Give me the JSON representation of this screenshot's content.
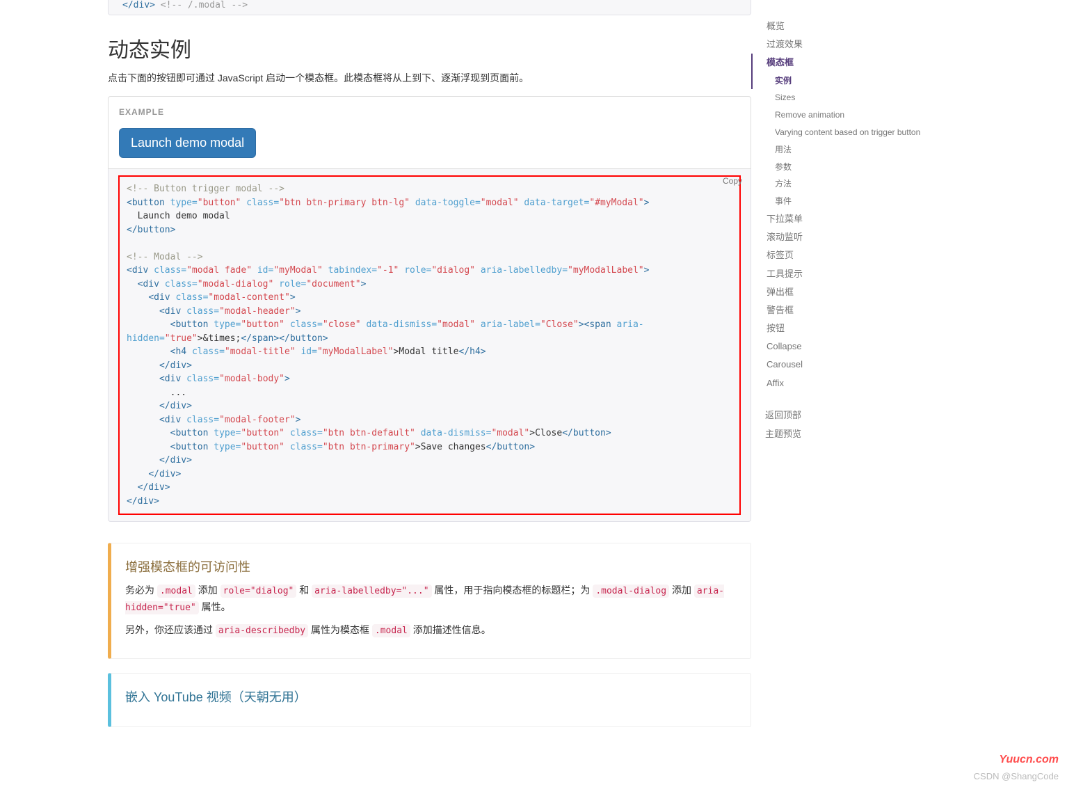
{
  "truncated_top": {
    "tag_close": "</div>",
    "comment": "<!-- /.modal -->"
  },
  "section": {
    "title": "动态实例",
    "lead": "点击下面的按钮即可通过 JavaScript 启动一个模态框。此模态框将从上到下、逐渐浮现到页面前。"
  },
  "example": {
    "label": "EXAMPLE",
    "button_label": "Launch demo modal"
  },
  "copy_label": "Copy",
  "code": {
    "c1": "<!-- Button trigger modal -->",
    "btn_open": "<button",
    "a_type": "type=",
    "v_button": "\"button\"",
    "a_class": "class=",
    "v_btn_primary": "\"btn btn-primary btn-lg\"",
    "a_toggle": "data-toggle=",
    "v_modal": "\"modal\"",
    "a_target": "data-target=",
    "v_myModal": "\"#myModal\"",
    "btn_inner": "  Launch demo modal",
    "btn_close": "</button>",
    "c2": "<!-- Modal -->",
    "div_open": "<div",
    "v_modal_fade": "\"modal fade\"",
    "a_id": "id=",
    "v_id_myModal": "\"myModal\"",
    "a_tabindex": "tabindex=",
    "v_neg1": "\"-1\"",
    "a_role": "role=",
    "v_dialog": "\"dialog\"",
    "a_labelledby": "aria-labelledby=",
    "v_labelledby": "\"myModalLabel\"",
    "v_modal_dialog": "\"modal-dialog\"",
    "v_document": "\"document\"",
    "v_modal_content": "\"modal-content\"",
    "v_modal_header": "\"modal-header\"",
    "v_close": "\"close\"",
    "a_dismiss": "data-dismiss=",
    "a_aria_label": "aria-label=",
    "v_Close": "\"Close\"",
    "span_open": "<span",
    "a_aria_hidden": "aria-hidden=",
    "v_true": "\"true\"",
    "times": ">&times;",
    "span_close": "</span>",
    "button_end": "</button>",
    "h4_open": "<h4",
    "v_modal_title": "\"modal-title\"",
    "v_id_label": "\"myModalLabel\"",
    "h4_text": ">Modal title",
    "h4_close": "</h4>",
    "div_close": "</div>",
    "v_modal_body": "\"modal-body\"",
    "ellipsis": "        ...",
    "v_modal_footer": "\"modal-footer\"",
    "v_btn_default": "\"btn btn-default\"",
    "close_text": ">Close",
    "v_btn_primary2": "\"btn btn-primary\"",
    "save_text": ">Save changes"
  },
  "callout_a11y": {
    "title": "增强模态框的可访问性",
    "p1_a": "务必为 ",
    "code1": ".modal",
    "p1_b": " 添加 ",
    "code2": "role=\"dialog\"",
    "p1_c": " 和 ",
    "code3": "aria-labelledby=\"...\"",
    "p1_d": " 属性，用于指向模态框的标题栏；为 ",
    "code4": ".modal-dialog",
    "p1_e": " 添加 ",
    "code5": "aria-hidden=\"true\"",
    "p1_f": " 属性。",
    "p2_a": "另外，你还应该通过 ",
    "code6": "aria-describedby",
    "p2_b": " 属性为模态框 ",
    "code7": ".modal",
    "p2_c": " 添加描述性信息。"
  },
  "callout_youtube": {
    "title": "嵌入 YouTube 视频（天朝无用）"
  },
  "sidebar": {
    "items": [
      {
        "label": "概览",
        "lvl": 1
      },
      {
        "label": "过渡效果",
        "lvl": 1
      },
      {
        "label": "模态框",
        "lvl": 1,
        "active": true
      },
      {
        "label": "实例",
        "lvl": 2,
        "active": true
      },
      {
        "label": "Sizes",
        "lvl": 2
      },
      {
        "label": "Remove animation",
        "lvl": 2
      },
      {
        "label": "Varying content based on trigger button",
        "lvl": 2
      },
      {
        "label": "用法",
        "lvl": 2
      },
      {
        "label": "参数",
        "lvl": 2
      },
      {
        "label": "方法",
        "lvl": 2
      },
      {
        "label": "事件",
        "lvl": 2
      },
      {
        "label": "下拉菜单",
        "lvl": 1
      },
      {
        "label": "滚动监听",
        "lvl": 1
      },
      {
        "label": "标签页",
        "lvl": 1
      },
      {
        "label": "工具提示",
        "lvl": 1
      },
      {
        "label": "弹出框",
        "lvl": 1
      },
      {
        "label": "警告框",
        "lvl": 1
      },
      {
        "label": "按钮",
        "lvl": 1
      },
      {
        "label": "Collapse",
        "lvl": 1
      },
      {
        "label": "Carousel",
        "lvl": 1
      },
      {
        "label": "Affix",
        "lvl": 1
      }
    ],
    "back_top": "返回顶部",
    "theme_preview": "主题预览"
  },
  "brand": "Yuucn.com",
  "watermark": "CSDN @ShangCode"
}
